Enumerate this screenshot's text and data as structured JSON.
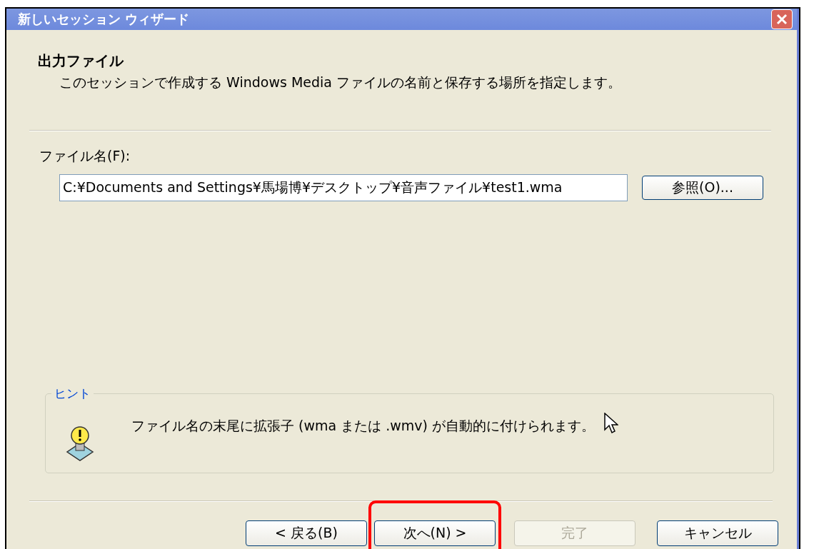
{
  "window": {
    "title": "新しいセッション ウィザード"
  },
  "header": {
    "title": "出力ファイル",
    "description": "このセッションで作成する Windows Media ファイルの名前と保存する場所を指定します。"
  },
  "file_name": {
    "label": "ファイル名(F):",
    "value": "C:¥Documents and Settings¥馬場博¥デスクトップ¥音声ファイル¥test1.wma",
    "browse_button": "参照(O)..."
  },
  "hint": {
    "title": "ヒント",
    "text": "ファイル名の末尾に拡張子 (wma または .wmv) が自動的に付けられます。"
  },
  "buttons": [
    {
      "label": "< 戻る(B)",
      "disabled": false,
      "highlighted": false
    },
    {
      "label": "次へ(N) >",
      "disabled": false,
      "highlighted": true
    },
    {
      "label": "完了",
      "disabled": true,
      "highlighted": false
    },
    {
      "label": "キャンセル",
      "disabled": false,
      "highlighted": false
    }
  ]
}
